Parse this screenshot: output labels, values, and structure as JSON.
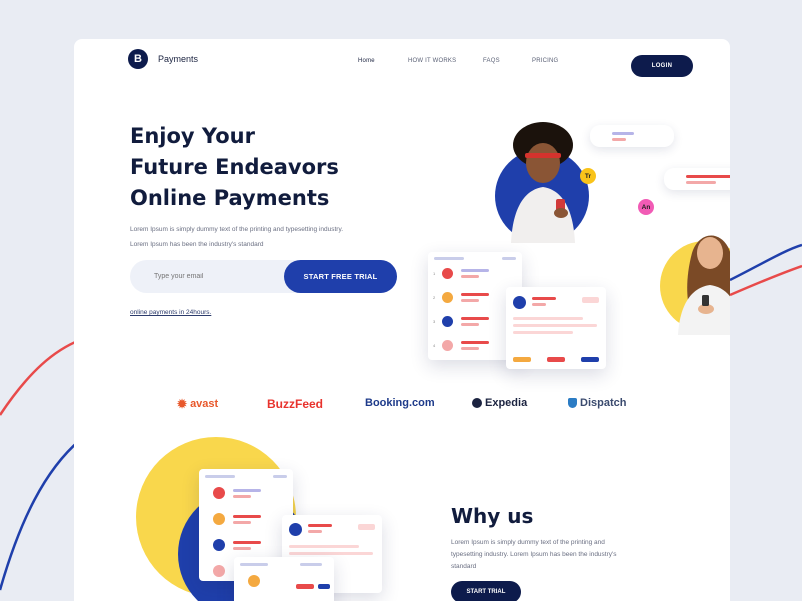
{
  "logo": {
    "glyph": "B",
    "name": "Payments"
  },
  "nav": {
    "items": [
      "Home",
      "HOW IT WORKS",
      "FAQS",
      "PRICING"
    ]
  },
  "header": {
    "login_label": "LOGIN"
  },
  "hero": {
    "title_lines": [
      "Enjoy Your",
      "Future Endeavors",
      "Online Payments"
    ],
    "desc_lines": [
      "Lorem Ipsum is simply dummy text of the printing and typesetting industry.",
      "Lorem Ipsum has been the industry's standard"
    ],
    "email_placeholder": "Type your email",
    "cta_label": "START FREE TRIAL",
    "link_text": "online payments in 24hours."
  },
  "illustration": {
    "badges": [
      "Tr",
      "An"
    ],
    "list_numbers": [
      "1",
      "2",
      "3",
      "4"
    ]
  },
  "brands": [
    "avast",
    "BuzzFeed",
    "Booking.com",
    "Expedia",
    "Dispatch"
  ],
  "why": {
    "title": "Why us",
    "desc": "Lorem Ipsum is simply dummy text of the printing and typesetting industry. Lorem Ipsum has been the industry's standard",
    "button_label": "START TRIAL"
  },
  "colors": {
    "navy": "#0d1b4c",
    "primary_blue": "#1f3fab",
    "yellow": "#f9d74c",
    "red": "#e84a4a",
    "orange": "#f4a940",
    "pink": "#f3a8a8"
  },
  "icons": [
    "logo-b-icon",
    "avast-logo-icon",
    "expedia-globe-icon",
    "dispatch-shield-icon"
  ]
}
